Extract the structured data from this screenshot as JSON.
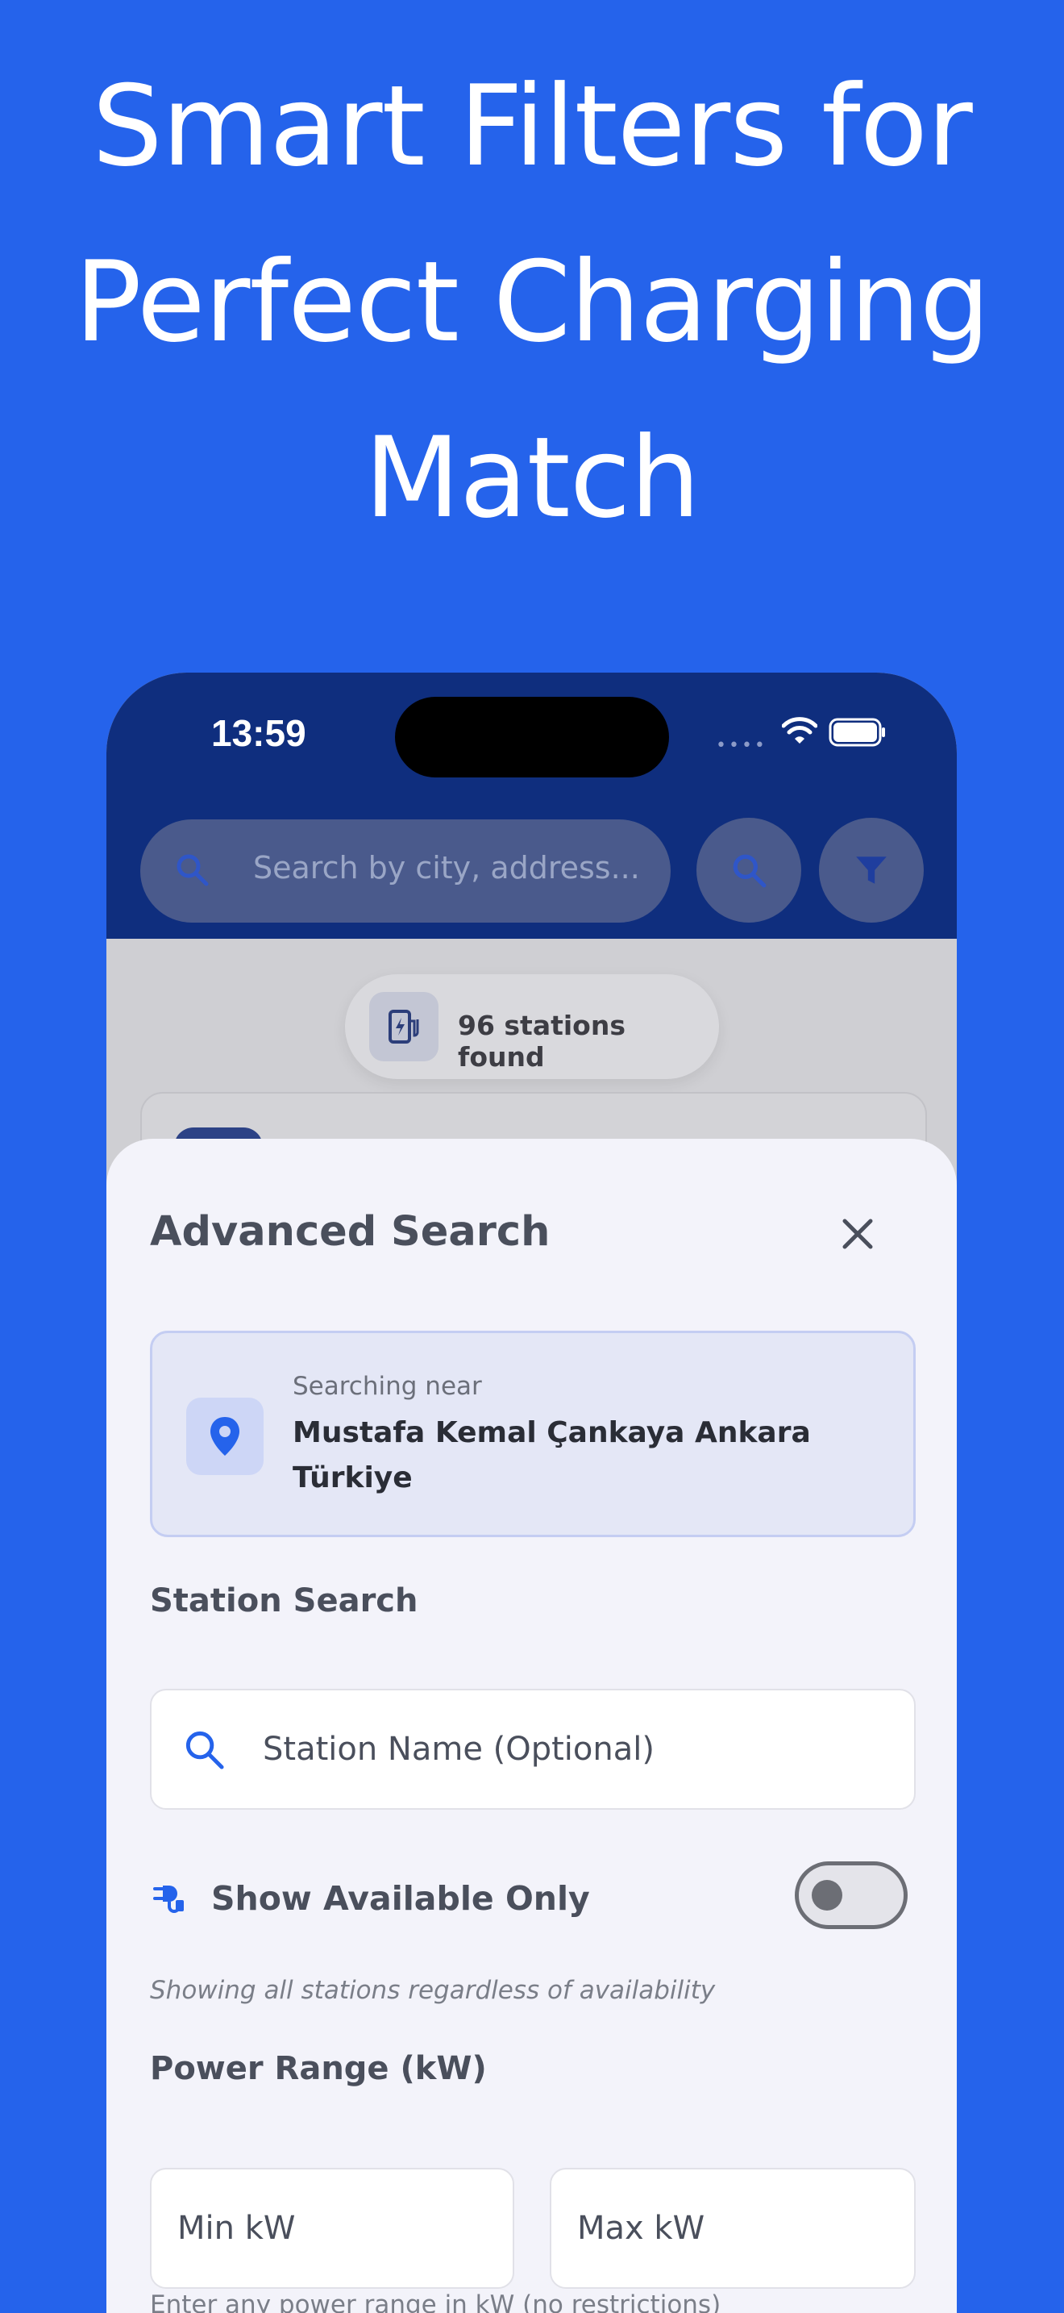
{
  "headline": {
    "line1": "Smart Filters for",
    "line2": "Perfect Charging",
    "line3": "Match"
  },
  "status_bar": {
    "time": "13:59"
  },
  "top_bar": {
    "search_placeholder": "Search by city, address..."
  },
  "results": {
    "count_label": "96 stations found"
  },
  "sheet": {
    "title": "Advanced Search",
    "location": {
      "caption": "Searching near",
      "address": "Mustafa Kemal Çankaya Ankara Türkiye"
    },
    "station_search": {
      "label": "Station Search",
      "placeholder": "Station Name (Optional)"
    },
    "availability": {
      "label": "Show Available Only",
      "enabled": false,
      "note": "Showing all stations regardless of availability"
    },
    "power_range": {
      "label": "Power Range (kW)",
      "min_placeholder": "Min kW",
      "max_placeholder": "Max kW",
      "note": "Enter any power range in kW (no restrictions)"
    }
  },
  "colors": {
    "brand_blue": "#2563EB",
    "header_navy": "#0F2E7E",
    "sheet_bg": "#F3F3FA",
    "location_card_bg": "#E4E7F6",
    "icon_blue": "#2563EB"
  },
  "icons": {
    "search": "search-icon",
    "filter": "funnel-icon",
    "close": "close-icon",
    "location": "location-pin-icon",
    "plug": "plug-icon",
    "charging_station": "charging-station-icon"
  }
}
